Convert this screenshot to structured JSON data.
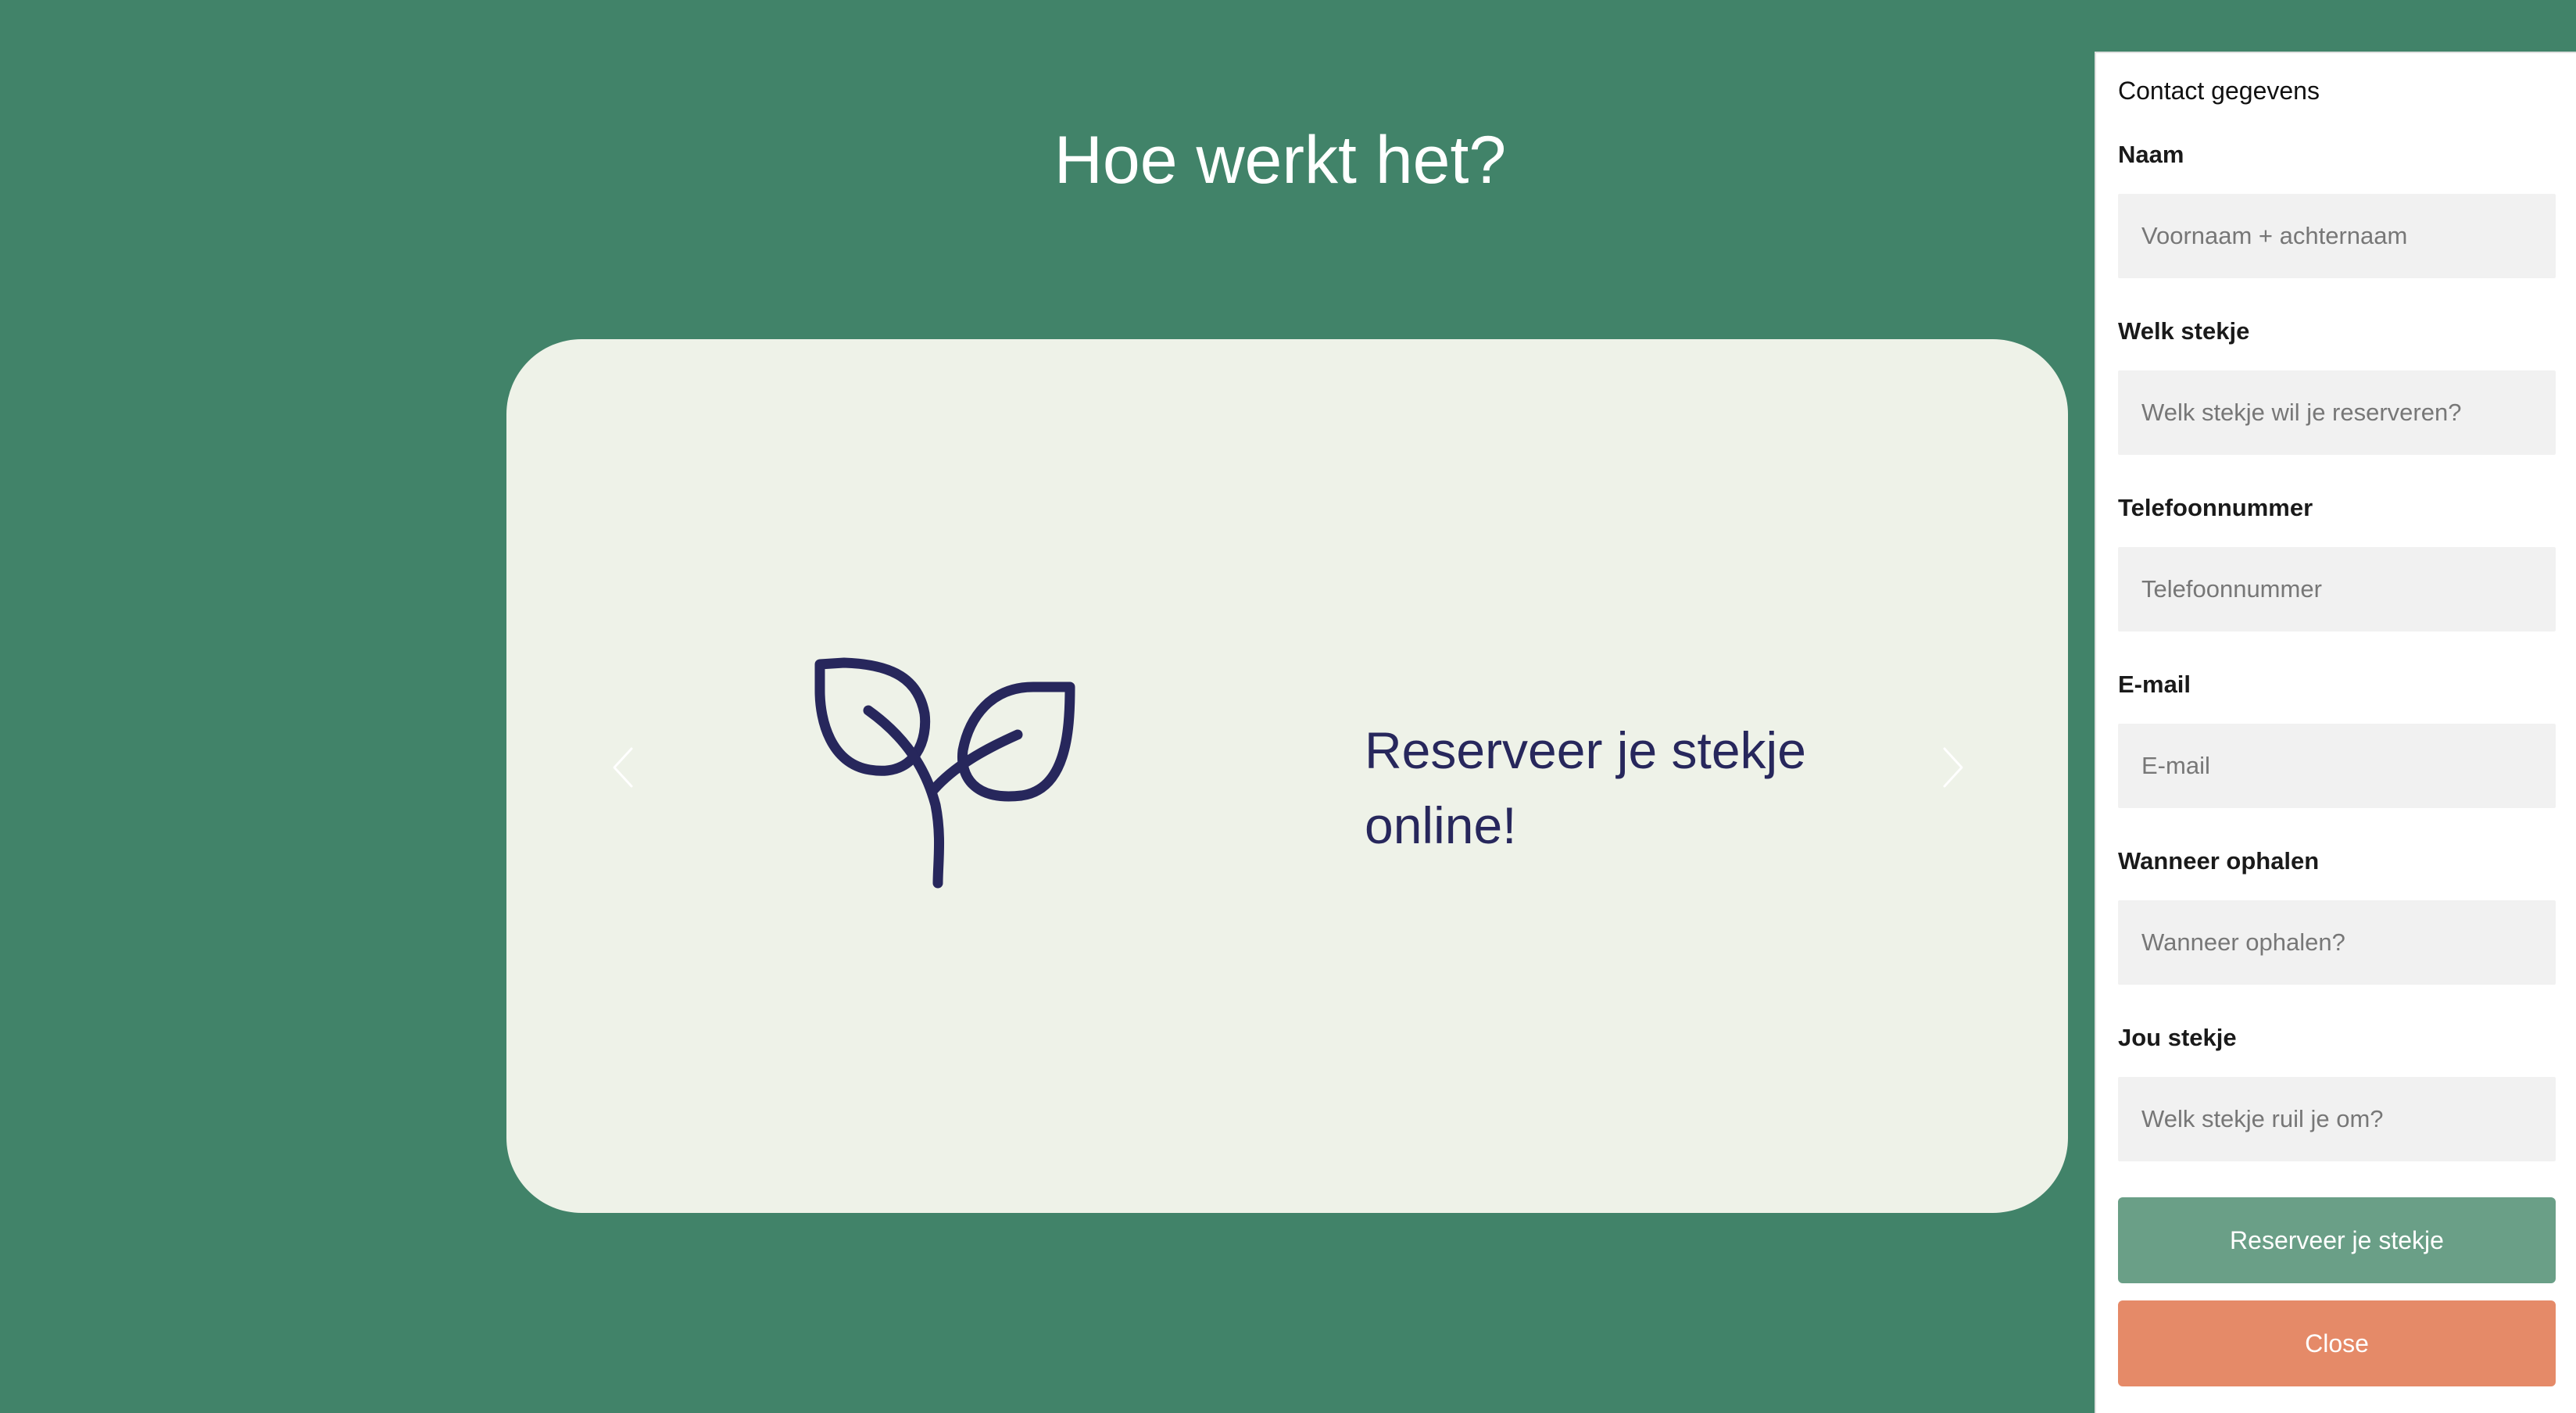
{
  "page": {
    "title": "Hoe werkt het?"
  },
  "carousel": {
    "slide_text": "Reserveer je stekje online!",
    "icon": "plant-sprout-icon",
    "prev_icon": "chevron-left-icon",
    "next_icon": "chevron-right-icon"
  },
  "form": {
    "heading": "Contact gegevens",
    "fields": [
      {
        "label": "Naam",
        "placeholder": "Voornaam + achternaam",
        "value": ""
      },
      {
        "label": "Welk stekje",
        "placeholder": "Welk stekje wil je reserveren?",
        "value": ""
      },
      {
        "label": "Telefoonnummer",
        "placeholder": "Telefoonnummer",
        "value": ""
      },
      {
        "label": "E-mail",
        "placeholder": "E-mail",
        "value": ""
      },
      {
        "label": "Wanneer ophalen",
        "placeholder": "Wanneer ophalen?",
        "value": ""
      },
      {
        "label": "Jou stekje",
        "placeholder": "Welk stekje ruil je om?",
        "value": ""
      }
    ],
    "submit_label": "Reserveer je stekje",
    "close_label": "Close"
  },
  "colors": {
    "background": "#418369",
    "card": "#eef2e8",
    "icon_text": "#27275c",
    "submit_button": "#6a9f87",
    "close_button": "#e58a68"
  }
}
